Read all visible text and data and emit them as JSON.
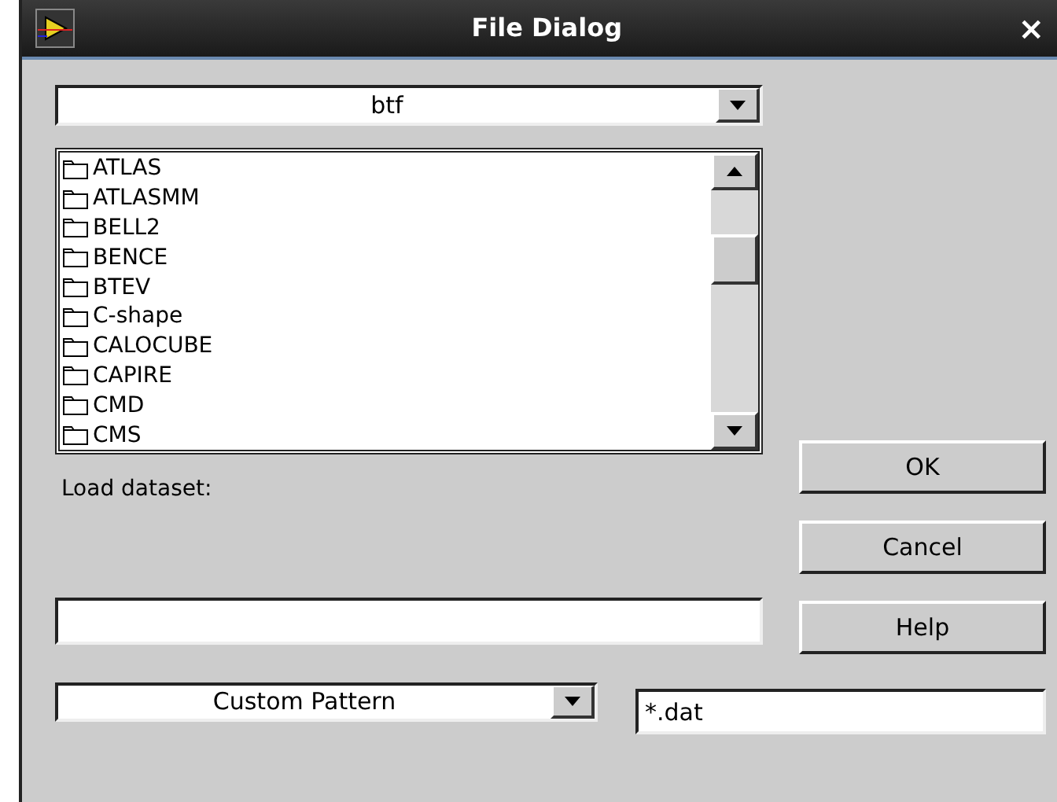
{
  "window": {
    "title": "File Dialog",
    "close": "×"
  },
  "directory": {
    "value": "btf"
  },
  "folders": [
    {
      "name": "ATLAS"
    },
    {
      "name": "ATLASMM"
    },
    {
      "name": "BELL2"
    },
    {
      "name": "BENCE"
    },
    {
      "name": "BTEV"
    },
    {
      "name": "C-shape"
    },
    {
      "name": "CALOCUBE"
    },
    {
      "name": "CAPIRE"
    },
    {
      "name": "CMD"
    },
    {
      "name": "CMS"
    }
  ],
  "load_label": "Load dataset:",
  "filter": {
    "value": "Custom Pattern"
  },
  "pattern_field": {
    "value": "*.dat"
  },
  "buttons": [
    {
      "label": "OK"
    },
    {
      "label": "Cancel"
    },
    {
      "label": "Help"
    }
  ]
}
